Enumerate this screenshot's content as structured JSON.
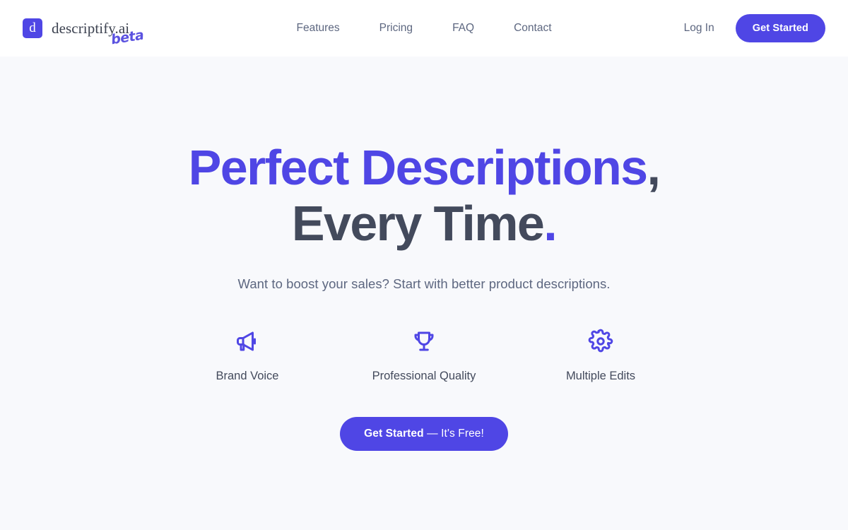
{
  "theme": {
    "accent": "#4f46e5",
    "text_dark": "#434a5c",
    "text_muted": "#5d6780",
    "header_bg": "#ffffff",
    "page_bg": "#f8f9fc"
  },
  "header": {
    "brand": {
      "mark_letter": "d",
      "wordmark": "descriptify.ai",
      "badge": "beta"
    },
    "nav": [
      {
        "label": "Features"
      },
      {
        "label": "Pricing"
      },
      {
        "label": "FAQ"
      },
      {
        "label": "Contact"
      }
    ],
    "login_label": "Log In",
    "get_started_label": "Get Started"
  },
  "hero": {
    "title_line1_accent": "Perfect Descriptions",
    "title_line1_punct": ",",
    "title_line2_dark": "Every Time",
    "title_line2_punct": ".",
    "subtitle": "Want to boost your sales? Start with better product descriptions.",
    "features": [
      {
        "icon": "megaphone-icon",
        "label": "Brand Voice"
      },
      {
        "icon": "trophy-icon",
        "label": "Professional Quality"
      },
      {
        "icon": "gear-icon",
        "label": "Multiple Edits"
      }
    ],
    "cta": {
      "strong": "Get Started",
      "soft": " — It's Free!"
    }
  }
}
